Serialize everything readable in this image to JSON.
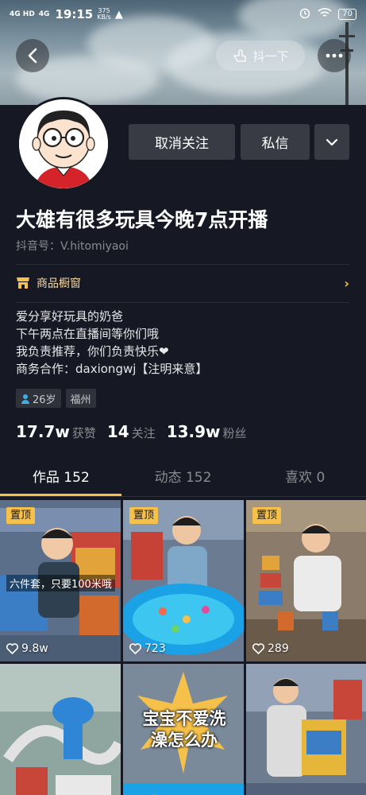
{
  "status_bar": {
    "signal_1": "4G HD",
    "signal_2": "4G",
    "time": "19:15",
    "speed_value": "375",
    "speed_unit": "KB/s",
    "battery": "70"
  },
  "header": {
    "shake_label": "抖一下"
  },
  "actions": {
    "unfollow": "取消关注",
    "message": "私信"
  },
  "profile": {
    "nickname": "大雄有很多玩具今晚7点开播",
    "douyin_id": "抖音号：V.hitomiyaoi",
    "shop_label": "商品橱窗",
    "bio": [
      "爱分享好玩具的奶爸",
      "下午两点在直播间等你们哦",
      "我负责推荐，你们负责快乐❤",
      "商务合作：daxiongwj【注明来意】"
    ],
    "tags": {
      "age": "26岁",
      "city": "福州"
    }
  },
  "stats": {
    "likes_value": "17.7w",
    "likes_label": "获赞",
    "following_value": "14",
    "following_label": "关注",
    "fans_value": "13.9w",
    "fans_label": "粉丝"
  },
  "tabs": [
    {
      "label": "作品 152",
      "active": true
    },
    {
      "label": "动态 152",
      "active": false
    },
    {
      "label": "喜欢 0",
      "active": false
    }
  ],
  "videos": [
    {
      "pinned": "置顶",
      "likes": "9.8w",
      "overlay": "六件套，只要100米哦"
    },
    {
      "pinned": "置顶",
      "likes": "723"
    },
    {
      "pinned": "置顶",
      "likes": "289"
    },
    {},
    {
      "caption": "宝宝不爱洗澡怎么办"
    },
    {}
  ],
  "colors": {
    "background": "#161823",
    "accent": "#f6c14a",
    "button": "#393b44",
    "muted_text": "#8a8b91"
  }
}
